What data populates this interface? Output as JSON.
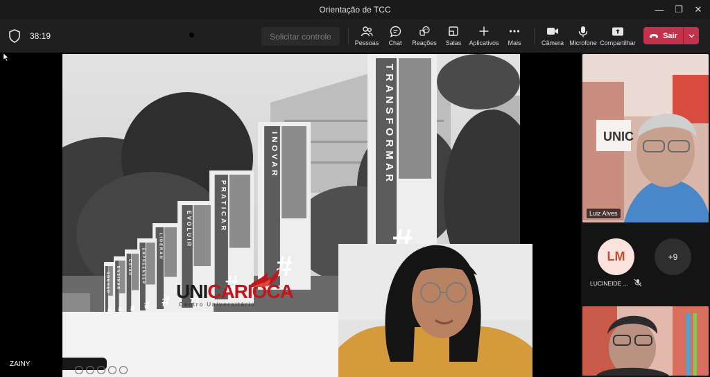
{
  "window": {
    "title": "Orientação de TCC",
    "minimize_glyph": "—",
    "maximize_glyph": "❐",
    "close_glyph": "✕"
  },
  "toolbar": {
    "timer": "38:19",
    "request_control": "Solicitar controle",
    "tools": [
      {
        "label": "Pessoas",
        "icon": "people-icon"
      },
      {
        "label": "Chat",
        "icon": "chat-icon"
      },
      {
        "label": "Reações",
        "icon": "reactions-icon"
      },
      {
        "label": "Salas",
        "icon": "rooms-icon"
      },
      {
        "label": "Aplicativos",
        "icon": "apps-icon"
      },
      {
        "label": "Mais",
        "icon": "more-icon"
      },
      {
        "label": "Câmera",
        "icon": "camera-icon"
      },
      {
        "label": "Microfone",
        "icon": "microphone-icon"
      },
      {
        "label": "Compartilhar",
        "icon": "share-icon"
      }
    ],
    "leave_label": "Sair",
    "leave_color": "#c4314b"
  },
  "slide": {
    "banners": [
      "TRANSFORMAR",
      "INOVAR",
      "PRATICAR",
      "EVOLUIR",
      "LIDERAR",
      "EMPREENDER",
      "CRIAR",
      "ENSINAR",
      "SONHAR"
    ],
    "banner_symbol": "#",
    "logo_main": "UNI",
    "logo_accent": "CARIOCA",
    "logo_sub": "Centro Universitário",
    "logo_color": "#c0161c"
  },
  "presenter": {
    "name": "ZAINY"
  },
  "participants": {
    "tiles": [
      {
        "name": "Luiz Alves"
      }
    ],
    "avatar_initials": "LM",
    "avatar_name": "LUCINEIDE ...",
    "overflow_count": "+9"
  }
}
